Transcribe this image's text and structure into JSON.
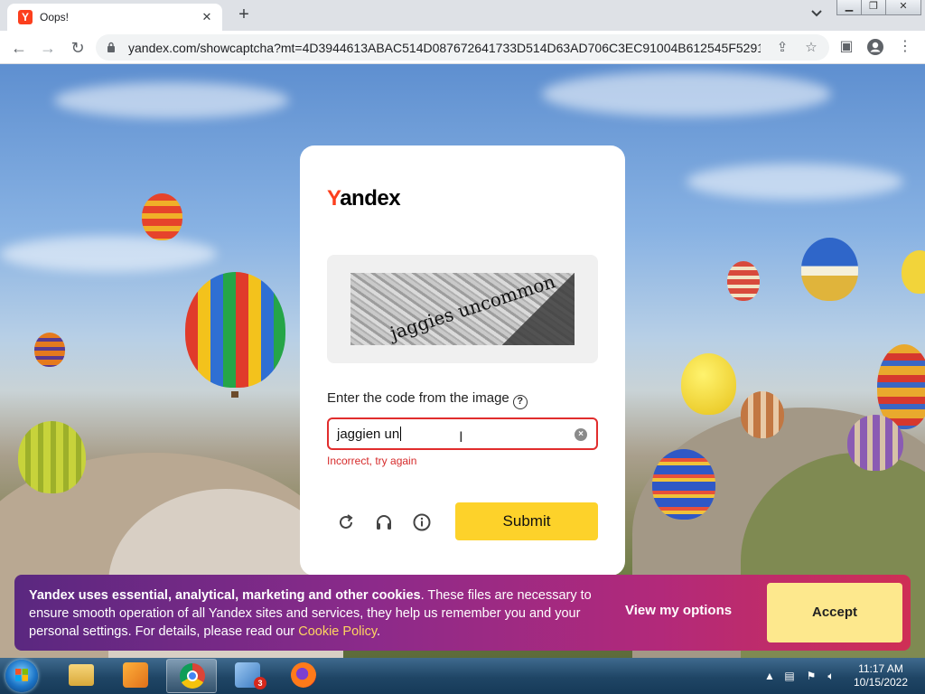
{
  "browser": {
    "tab": {
      "favicon_letter": "Y",
      "title": "Oops!",
      "close_glyph": "✕"
    },
    "new_tab_glyph": "+",
    "address_bar": {
      "url": "yandex.com/showcaptcha?mt=4D3944613ABAC514D087672641733D514D63AD706C3EC91004B612545F5291E7..."
    },
    "icons": [
      "back-icon",
      "forward-icon",
      "reload-icon",
      "lock-icon",
      "share-icon",
      "star-icon",
      "side-panel-icon",
      "profile-icon",
      "more-menu-icon"
    ]
  },
  "captcha": {
    "brand_y": "Y",
    "brand_rest": "andex",
    "captcha_image_text": "jaggies uncommon",
    "prompt": "Enter the code from the image",
    "help_glyph": "?",
    "input_value": "jaggien un",
    "error": "Incorrect, try again",
    "submit_label": "Submit"
  },
  "cookie_banner": {
    "bold_text": "Yandex uses essential, analytical, marketing and other cookies",
    "body_text": ". These files are necessary to ensure smooth operation of all Yandex sites and services, they help us remember you and your personal settings. For details, please read our ",
    "link_text": "Cookie Policy",
    "tail_text": ".",
    "options_label": "View my options",
    "accept_label": "Accept"
  },
  "taskbar": {
    "apps": [
      "start-button",
      "file-explorer",
      "media-player",
      "chrome",
      "search-tool",
      "firefox"
    ],
    "notification_count": "3",
    "time": "11:17 AM",
    "date": "10/15/2022"
  },
  "colors": {
    "brand_red": "#fc3f1d",
    "submit_yellow": "#fdd22a",
    "error_red": "#e12d2d",
    "cookie_link": "#ffd560"
  }
}
